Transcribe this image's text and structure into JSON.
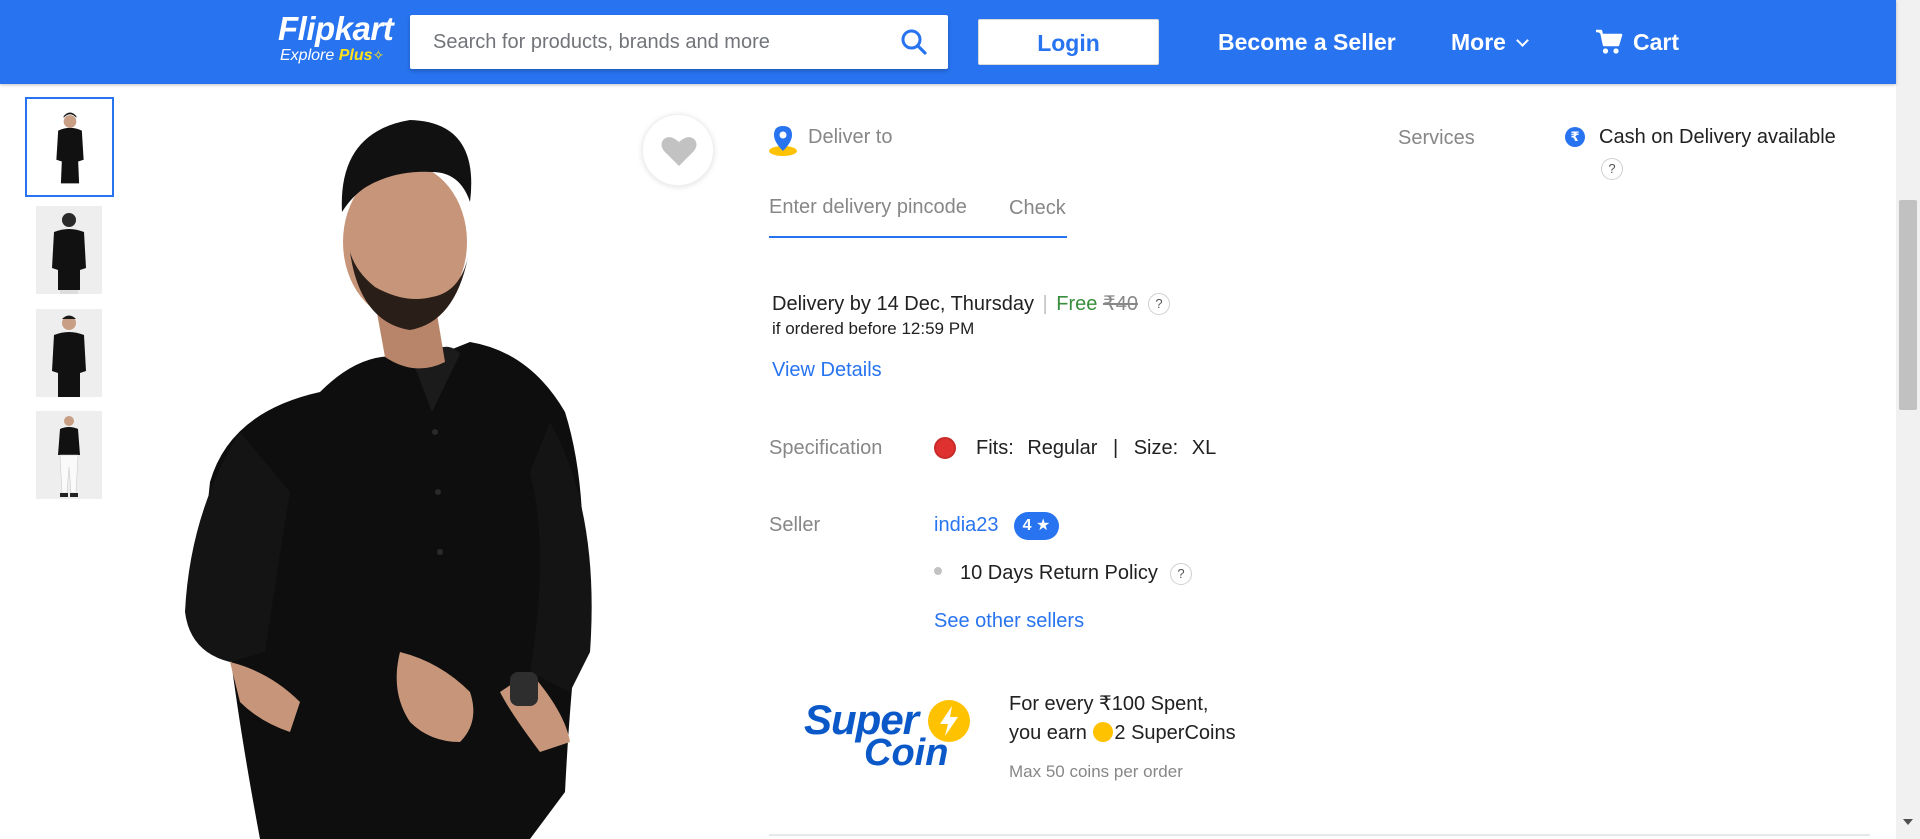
{
  "header": {
    "logo_text": "Flipkart",
    "logo_sub_prefix": "Explore ",
    "logo_sub_plus": "Plus",
    "search_placeholder": "Search for products, brands and more",
    "login_label": "Login",
    "become_seller_label": "Become a Seller",
    "more_label": "More",
    "cart_label": "Cart",
    "brand_color": "#2874f0"
  },
  "gallery": {
    "thumbnails": 4,
    "active_index": 0
  },
  "delivery": {
    "deliver_to_label": "Deliver to",
    "pincode_placeholder": "Enter delivery pincode",
    "check_label": "Check",
    "delivery_line": "Delivery by 14 Dec, Thursday",
    "separator": "|",
    "free_label": "Free",
    "original_charge": "₹40",
    "cutoff": "if ordered before 12:59 PM",
    "view_details": "View Details"
  },
  "services": {
    "label": "Services",
    "rupee_symbol": "₹",
    "cod": "Cash on Delivery available"
  },
  "specification": {
    "label": "Specification",
    "fits_label": "Fits:",
    "fits_value": "Regular",
    "separator": "|",
    "size_label": "Size:",
    "size_value": "XL"
  },
  "seller": {
    "label": "Seller",
    "name": "india23",
    "rating": "4",
    "return_policy": "10 Days Return Policy",
    "see_other": "See other sellers"
  },
  "supercoin": {
    "logo_line1": "Super",
    "logo_line2": "Coin",
    "line1": "For every ₹100 Spent,",
    "line2_prefix": "you earn",
    "line2_suffix": "2 SuperCoins",
    "note": "Max 50 coins per order"
  },
  "help_glyph": "?"
}
